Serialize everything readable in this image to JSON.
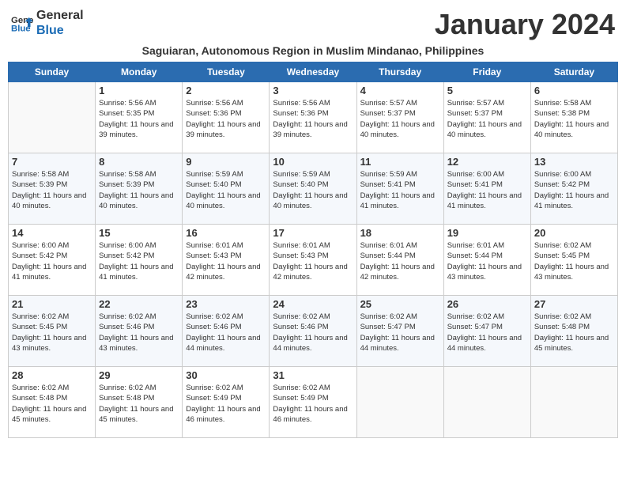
{
  "logo": {
    "line1": "General",
    "line2": "Blue"
  },
  "title": "January 2024",
  "subtitle": "Saguiaran, Autonomous Region in Muslim Mindanao, Philippines",
  "weekdays": [
    "Sunday",
    "Monday",
    "Tuesday",
    "Wednesday",
    "Thursday",
    "Friday",
    "Saturday"
  ],
  "weeks": [
    [
      {
        "day": "",
        "sunrise": "",
        "sunset": "",
        "daylight": ""
      },
      {
        "day": "1",
        "sunrise": "Sunrise: 5:56 AM",
        "sunset": "Sunset: 5:35 PM",
        "daylight": "Daylight: 11 hours and 39 minutes."
      },
      {
        "day": "2",
        "sunrise": "Sunrise: 5:56 AM",
        "sunset": "Sunset: 5:36 PM",
        "daylight": "Daylight: 11 hours and 39 minutes."
      },
      {
        "day": "3",
        "sunrise": "Sunrise: 5:56 AM",
        "sunset": "Sunset: 5:36 PM",
        "daylight": "Daylight: 11 hours and 39 minutes."
      },
      {
        "day": "4",
        "sunrise": "Sunrise: 5:57 AM",
        "sunset": "Sunset: 5:37 PM",
        "daylight": "Daylight: 11 hours and 40 minutes."
      },
      {
        "day": "5",
        "sunrise": "Sunrise: 5:57 AM",
        "sunset": "Sunset: 5:37 PM",
        "daylight": "Daylight: 11 hours and 40 minutes."
      },
      {
        "day": "6",
        "sunrise": "Sunrise: 5:58 AM",
        "sunset": "Sunset: 5:38 PM",
        "daylight": "Daylight: 11 hours and 40 minutes."
      }
    ],
    [
      {
        "day": "7",
        "sunrise": "Sunrise: 5:58 AM",
        "sunset": "Sunset: 5:39 PM",
        "daylight": "Daylight: 11 hours and 40 minutes."
      },
      {
        "day": "8",
        "sunrise": "Sunrise: 5:58 AM",
        "sunset": "Sunset: 5:39 PM",
        "daylight": "Daylight: 11 hours and 40 minutes."
      },
      {
        "day": "9",
        "sunrise": "Sunrise: 5:59 AM",
        "sunset": "Sunset: 5:40 PM",
        "daylight": "Daylight: 11 hours and 40 minutes."
      },
      {
        "day": "10",
        "sunrise": "Sunrise: 5:59 AM",
        "sunset": "Sunset: 5:40 PM",
        "daylight": "Daylight: 11 hours and 40 minutes."
      },
      {
        "day": "11",
        "sunrise": "Sunrise: 5:59 AM",
        "sunset": "Sunset: 5:41 PM",
        "daylight": "Daylight: 11 hours and 41 minutes."
      },
      {
        "day": "12",
        "sunrise": "Sunrise: 6:00 AM",
        "sunset": "Sunset: 5:41 PM",
        "daylight": "Daylight: 11 hours and 41 minutes."
      },
      {
        "day": "13",
        "sunrise": "Sunrise: 6:00 AM",
        "sunset": "Sunset: 5:42 PM",
        "daylight": "Daylight: 11 hours and 41 minutes."
      }
    ],
    [
      {
        "day": "14",
        "sunrise": "Sunrise: 6:00 AM",
        "sunset": "Sunset: 5:42 PM",
        "daylight": "Daylight: 11 hours and 41 minutes."
      },
      {
        "day": "15",
        "sunrise": "Sunrise: 6:00 AM",
        "sunset": "Sunset: 5:42 PM",
        "daylight": "Daylight: 11 hours and 41 minutes."
      },
      {
        "day": "16",
        "sunrise": "Sunrise: 6:01 AM",
        "sunset": "Sunset: 5:43 PM",
        "daylight": "Daylight: 11 hours and 42 minutes."
      },
      {
        "day": "17",
        "sunrise": "Sunrise: 6:01 AM",
        "sunset": "Sunset: 5:43 PM",
        "daylight": "Daylight: 11 hours and 42 minutes."
      },
      {
        "day": "18",
        "sunrise": "Sunrise: 6:01 AM",
        "sunset": "Sunset: 5:44 PM",
        "daylight": "Daylight: 11 hours and 42 minutes."
      },
      {
        "day": "19",
        "sunrise": "Sunrise: 6:01 AM",
        "sunset": "Sunset: 5:44 PM",
        "daylight": "Daylight: 11 hours and 43 minutes."
      },
      {
        "day": "20",
        "sunrise": "Sunrise: 6:02 AM",
        "sunset": "Sunset: 5:45 PM",
        "daylight": "Daylight: 11 hours and 43 minutes."
      }
    ],
    [
      {
        "day": "21",
        "sunrise": "Sunrise: 6:02 AM",
        "sunset": "Sunset: 5:45 PM",
        "daylight": "Daylight: 11 hours and 43 minutes."
      },
      {
        "day": "22",
        "sunrise": "Sunrise: 6:02 AM",
        "sunset": "Sunset: 5:46 PM",
        "daylight": "Daylight: 11 hours and 43 minutes."
      },
      {
        "day": "23",
        "sunrise": "Sunrise: 6:02 AM",
        "sunset": "Sunset: 5:46 PM",
        "daylight": "Daylight: 11 hours and 44 minutes."
      },
      {
        "day": "24",
        "sunrise": "Sunrise: 6:02 AM",
        "sunset": "Sunset: 5:46 PM",
        "daylight": "Daylight: 11 hours and 44 minutes."
      },
      {
        "day": "25",
        "sunrise": "Sunrise: 6:02 AM",
        "sunset": "Sunset: 5:47 PM",
        "daylight": "Daylight: 11 hours and 44 minutes."
      },
      {
        "day": "26",
        "sunrise": "Sunrise: 6:02 AM",
        "sunset": "Sunset: 5:47 PM",
        "daylight": "Daylight: 11 hours and 44 minutes."
      },
      {
        "day": "27",
        "sunrise": "Sunrise: 6:02 AM",
        "sunset": "Sunset: 5:48 PM",
        "daylight": "Daylight: 11 hours and 45 minutes."
      }
    ],
    [
      {
        "day": "28",
        "sunrise": "Sunrise: 6:02 AM",
        "sunset": "Sunset: 5:48 PM",
        "daylight": "Daylight: 11 hours and 45 minutes."
      },
      {
        "day": "29",
        "sunrise": "Sunrise: 6:02 AM",
        "sunset": "Sunset: 5:48 PM",
        "daylight": "Daylight: 11 hours and 45 minutes."
      },
      {
        "day": "30",
        "sunrise": "Sunrise: 6:02 AM",
        "sunset": "Sunset: 5:49 PM",
        "daylight": "Daylight: 11 hours and 46 minutes."
      },
      {
        "day": "31",
        "sunrise": "Sunrise: 6:02 AM",
        "sunset": "Sunset: 5:49 PM",
        "daylight": "Daylight: 11 hours and 46 minutes."
      },
      {
        "day": "",
        "sunrise": "",
        "sunset": "",
        "daylight": ""
      },
      {
        "day": "",
        "sunrise": "",
        "sunset": "",
        "daylight": ""
      },
      {
        "day": "",
        "sunrise": "",
        "sunset": "",
        "daylight": ""
      }
    ]
  ]
}
